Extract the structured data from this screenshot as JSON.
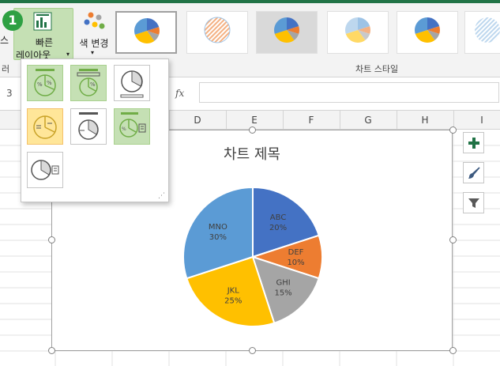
{
  "ribbon": {
    "quick_layout": {
      "label_line1": "빠른",
      "label_line2": "레이아웃",
      "step_badge": "1"
    },
    "left_edge_fragment": "스",
    "change_colors": {
      "label": "색 변경"
    },
    "group_labels": {
      "left_fragment": "러",
      "chart_styles": "차트 스타일"
    }
  },
  "formula_bar": {
    "fx_label": "fx",
    "row_fragment": "3"
  },
  "columns": [
    "D",
    "E",
    "F",
    "G",
    "H",
    "I"
  ],
  "chart": {
    "title": "차트 제목",
    "colors": {
      "ABC": "#4472c4",
      "DEF": "#ed7d31",
      "GHI": "#a5a5a5",
      "JKL": "#ffc000",
      "MNO": "#5b9bd5"
    }
  },
  "chart_data": {
    "type": "pie",
    "title": "차트 제목",
    "categories": [
      "ABC",
      "DEF",
      "GHI",
      "JKL",
      "MNO"
    ],
    "values": [
      20,
      10,
      15,
      25,
      30
    ],
    "labels": [
      "20%",
      "10%",
      "15%",
      "25%",
      "30%"
    ]
  },
  "icons": {
    "plus": "plus-icon",
    "brush": "brush-icon",
    "filter": "filter-icon"
  }
}
